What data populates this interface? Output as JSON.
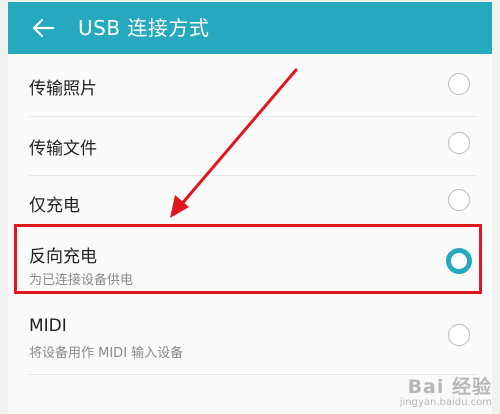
{
  "header": {
    "title": "USB 连接方式"
  },
  "options": [
    {
      "label": "传输照片",
      "selected": false
    },
    {
      "label": "传输文件",
      "selected": false
    },
    {
      "label": "仅充电",
      "selected": false
    },
    {
      "label": "反向充电",
      "sub": "为已连接设备供电",
      "selected": true
    },
    {
      "label": "MIDI",
      "sub": "将设备用作 MIDI 输入设备",
      "selected": false
    }
  ],
  "watermark": {
    "brand": "Bai 经验",
    "url": "jingyan.baidu.com"
  },
  "colors": {
    "accent": "#26a8bf",
    "annotation": "#e0161e"
  },
  "icons": {
    "back": "arrow-left-icon",
    "annotation": "red-arrow"
  }
}
